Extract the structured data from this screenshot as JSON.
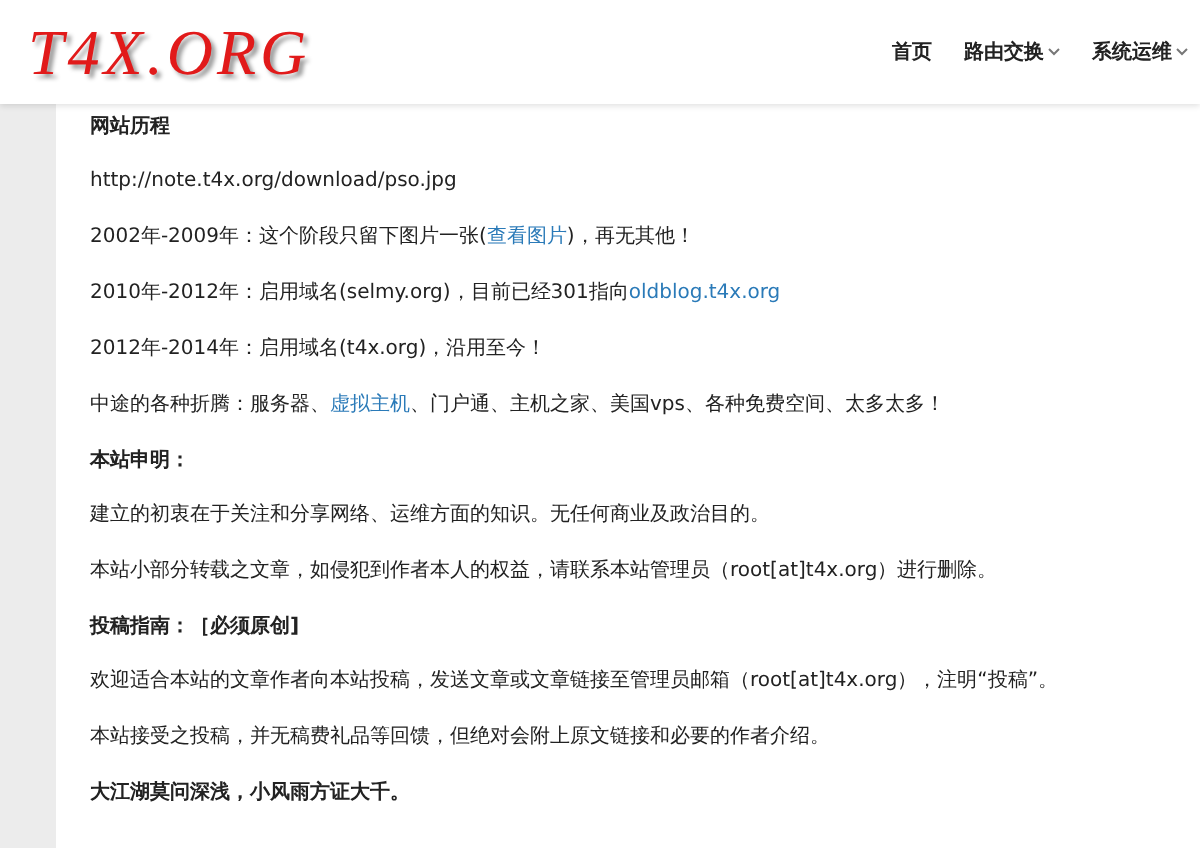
{
  "header": {
    "logo": "T4X.ORG",
    "nav": [
      {
        "label": "首页",
        "dropdown": false
      },
      {
        "label": "路由交换",
        "dropdown": true
      },
      {
        "label": "系统运维",
        "dropdown": true
      }
    ]
  },
  "content": [
    {
      "kind": "heading",
      "parts": [
        {
          "text": "网站历程",
          "link": false
        }
      ]
    },
    {
      "kind": "text",
      "parts": [
        {
          "text": "http://note.t4x.org/download/pso.jpg",
          "link": false
        }
      ]
    },
    {
      "kind": "text",
      "parts": [
        {
          "text": "2002年-2009年：这个阶段只留下图片一张(",
          "link": false
        },
        {
          "text": "查看图片",
          "link": true
        },
        {
          "text": ")，再无其他！",
          "link": false
        }
      ]
    },
    {
      "kind": "text",
      "parts": [
        {
          "text": "2010年-2012年：启用域名(selmy.org)，目前已经301指向",
          "link": false
        },
        {
          "text": "oldblog.t4x.org",
          "link": true
        }
      ]
    },
    {
      "kind": "text",
      "parts": [
        {
          "text": "2012年-2014年：启用域名(t4x.org)，沿用至今！",
          "link": false
        }
      ]
    },
    {
      "kind": "text",
      "parts": [
        {
          "text": "中途的各种折腾：服务器、",
          "link": false
        },
        {
          "text": "虚拟主机",
          "link": true
        },
        {
          "text": "、门户通、主机之家、美国vps、各种免费空间、太多太多！",
          "link": false
        }
      ]
    },
    {
      "kind": "heading",
      "parts": [
        {
          "text": "本站申明：",
          "link": false
        }
      ]
    },
    {
      "kind": "text",
      "parts": [
        {
          "text": "建立的初衷在于关注和分享网络、运维方面的知识。无任何商业及政治目的。",
          "link": false
        }
      ]
    },
    {
      "kind": "text",
      "parts": [
        {
          "text": "本站小部分转载之文章，如侵犯到作者本人的权益，请联系本站管理员（root[at]t4x.org）进行删除。",
          "link": false
        }
      ]
    },
    {
      "kind": "heading",
      "parts": [
        {
          "text": "投稿指南：［必须原创]",
          "link": false
        }
      ]
    },
    {
      "kind": "text",
      "parts": [
        {
          "text": "欢迎适合本站的文章作者向本站投稿，发送文章或文章链接至管理员邮箱（root[at]t4x.org），注明“投稿”。",
          "link": false
        }
      ]
    },
    {
      "kind": "text",
      "parts": [
        {
          "text": "本站接受之投稿，并无稿费礼品等回馈，但绝对会附上原文链接和必要的作者介绍。",
          "link": false
        }
      ]
    },
    {
      "kind": "heading",
      "parts": [
        {
          "text": "大江湖莫问深浅，小风雨方证大千。",
          "link": false
        }
      ]
    }
  ]
}
